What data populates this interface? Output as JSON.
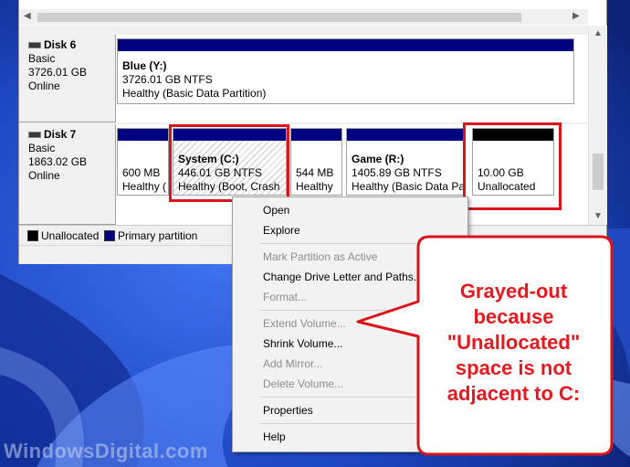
{
  "disks": [
    {
      "name": "Disk 6",
      "type": "Basic",
      "size": "3726.01 GB",
      "status": "Online",
      "partitions": [
        {
          "title": "Blue  (Y:)",
          "size": "3726.01 GB NTFS",
          "status": "Healthy (Basic Data Partition)"
        }
      ]
    },
    {
      "name": "Disk 7",
      "type": "Basic",
      "size": "1863.02 GB",
      "status": "Online",
      "partitions": [
        {
          "title": "",
          "size": "600 MB",
          "status": "Healthy ("
        },
        {
          "title": "System  (C:)",
          "size": "446.01 GB NTFS",
          "status": "Healthy (Boot, Crash"
        },
        {
          "title": "",
          "size": "544 MB",
          "status": "Healthy"
        },
        {
          "title": "Game  (R:)",
          "size": "1405.89 GB NTFS",
          "status": "Healthy (Basic Data Par"
        },
        {
          "title": "",
          "size": "10.00 GB",
          "status": "Unallocated"
        }
      ]
    }
  ],
  "legend": {
    "unallocated": "Unallocated",
    "primary": "Primary partition"
  },
  "menu": {
    "open": "Open",
    "explore": "Explore",
    "mark_active": "Mark Partition as Active",
    "change_letter": "Change Drive Letter and Paths...",
    "format": "Format...",
    "extend": "Extend Volume...",
    "shrink": "Shrink Volume...",
    "add_mirror": "Add Mirror...",
    "delete": "Delete Volume...",
    "properties": "Properties",
    "help": "Help"
  },
  "callout": {
    "line1": "Grayed-out",
    "line2": "because",
    "line3": "\"Unallocated\"",
    "line4": "space is not",
    "line5": "adjacent to C:"
  },
  "watermark": "WindowsDigital.com",
  "colors": {
    "primary_partition": "#000080",
    "unallocated": "#000000",
    "highlight": "#d9141b",
    "callout_text": "#e5191f"
  }
}
